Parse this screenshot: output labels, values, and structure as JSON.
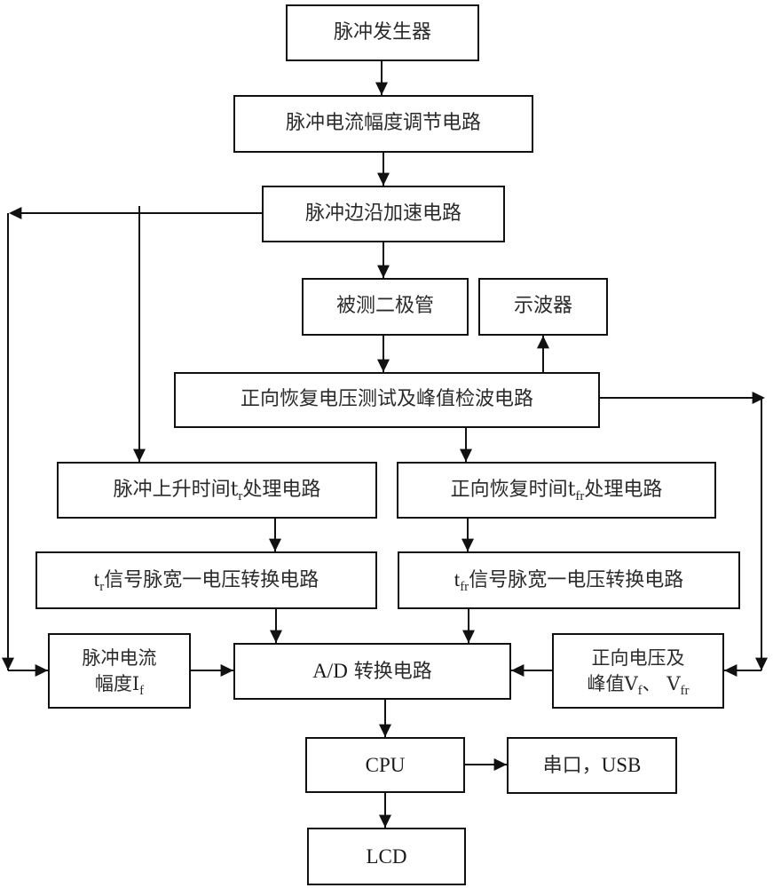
{
  "diagram": {
    "type": "block-diagram",
    "nodes": {
      "pulse_generator": {
        "label": "脉冲发生器"
      },
      "amplitude_adjust": {
        "label": "脉冲电流幅度调节电路"
      },
      "edge_accel": {
        "label": "脉冲边沿加速电路"
      },
      "diode_under_test": {
        "label": "被测二极管"
      },
      "oscilloscope": {
        "label": "示波器"
      },
      "peak_detect": {
        "label": "正向恢复电压测试及峰值检波电路"
      },
      "rise_time_proc": {
        "label_pre": "脉冲上升时间t",
        "label_sub": "r",
        "label_post": "处理电路"
      },
      "fwd_recovery_proc": {
        "label_pre": "正向恢复时间t",
        "label_sub": "fr",
        "label_post": "处理电路"
      },
      "tr_pw_voltage": {
        "label_pre": "t",
        "label_sub": "r",
        "label_post": "信号脉宽一电压转换电路"
      },
      "tfr_pw_voltage": {
        "label_pre": "t",
        "label_sub": "fr",
        "label_post": "信号脉宽一电压转换电路"
      },
      "pulse_current_amp": {
        "line1": "脉冲电流",
        "line2_pre": "幅度I",
        "line2_sub": "f"
      },
      "ad_converter": {
        "label_latin": "A/D",
        "label_cn": " 转换电路"
      },
      "fwd_voltage_peak": {
        "line1": "正向电压及",
        "line2_pre": "峰值V",
        "line2_sub1": "f",
        "line2_mid": "、 V",
        "line2_sub2": "fr"
      },
      "cpu": {
        "label": "CPU"
      },
      "serial_usb": {
        "label_cn": "串口，",
        "label_latin": "USB"
      },
      "lcd": {
        "label": "LCD"
      }
    },
    "edges": [
      [
        "pulse_generator",
        "amplitude_adjust"
      ],
      [
        "amplitude_adjust",
        "edge_accel"
      ],
      [
        "edge_accel",
        "diode_under_test"
      ],
      [
        "edge_accel",
        "rise_time_proc"
      ],
      [
        "edge_accel",
        "pulse_current_amp"
      ],
      [
        "diode_under_test",
        "peak_detect"
      ],
      [
        "peak_detect",
        "oscilloscope"
      ],
      [
        "peak_detect",
        "fwd_recovery_proc"
      ],
      [
        "peak_detect",
        "fwd_voltage_peak"
      ],
      [
        "rise_time_proc",
        "tr_pw_voltage"
      ],
      [
        "fwd_recovery_proc",
        "tfr_pw_voltage"
      ],
      [
        "tr_pw_voltage",
        "ad_converter"
      ],
      [
        "tfr_pw_voltage",
        "ad_converter"
      ],
      [
        "pulse_current_amp",
        "ad_converter"
      ],
      [
        "fwd_voltage_peak",
        "ad_converter"
      ],
      [
        "ad_converter",
        "cpu"
      ],
      [
        "cpu",
        "serial_usb"
      ],
      [
        "cpu",
        "lcd"
      ]
    ]
  },
  "colors": {
    "line": "#111111",
    "text": "#2b2b2b",
    "background": "#ffffff"
  }
}
